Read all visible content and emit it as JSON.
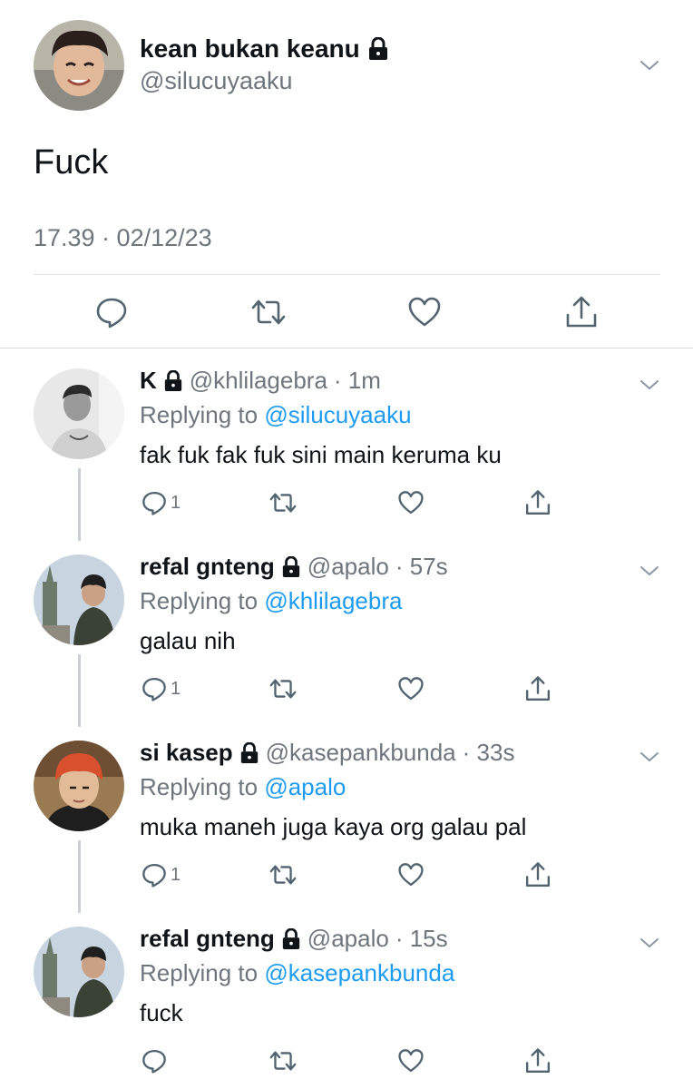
{
  "main": {
    "name": "kean bukan keanu",
    "handle": "@silucuyaaku",
    "text": "Fuck",
    "timestamp": "17.39 · 02/12/23",
    "avatar_desc": "smiling-person-avatar"
  },
  "replies": [
    {
      "name": "K",
      "handle": "@khlilagebra",
      "time": "· 1m",
      "replying_prefix": "Replying to",
      "replying_to": "@silucuyaaku",
      "text": "fak fuk fak fuk sini main keruma ku",
      "reply_count": "1"
    },
    {
      "name": "refal gnteng",
      "handle": "@apalo",
      "time": "· 57s",
      "replying_prefix": "Replying to",
      "replying_to": "@khlilagebra",
      "text": "galau nih",
      "reply_count": "1"
    },
    {
      "name": "si kasep",
      "handle": "@kasepankbunda",
      "time": "· 33s",
      "replying_prefix": "Replying to",
      "replying_to": "@apalo",
      "text": "muka maneh juga kaya org galau pal",
      "reply_count": "1"
    },
    {
      "name": "refal gnteng",
      "handle": "@apalo",
      "time": "· 15s",
      "replying_prefix": "Replying to",
      "replying_to": "@kasepankbunda",
      "text": "fuck",
      "reply_count": ""
    }
  ],
  "colors": {
    "accent": "#1d9bf0",
    "muted": "#6e767d",
    "text": "#0f1419"
  }
}
